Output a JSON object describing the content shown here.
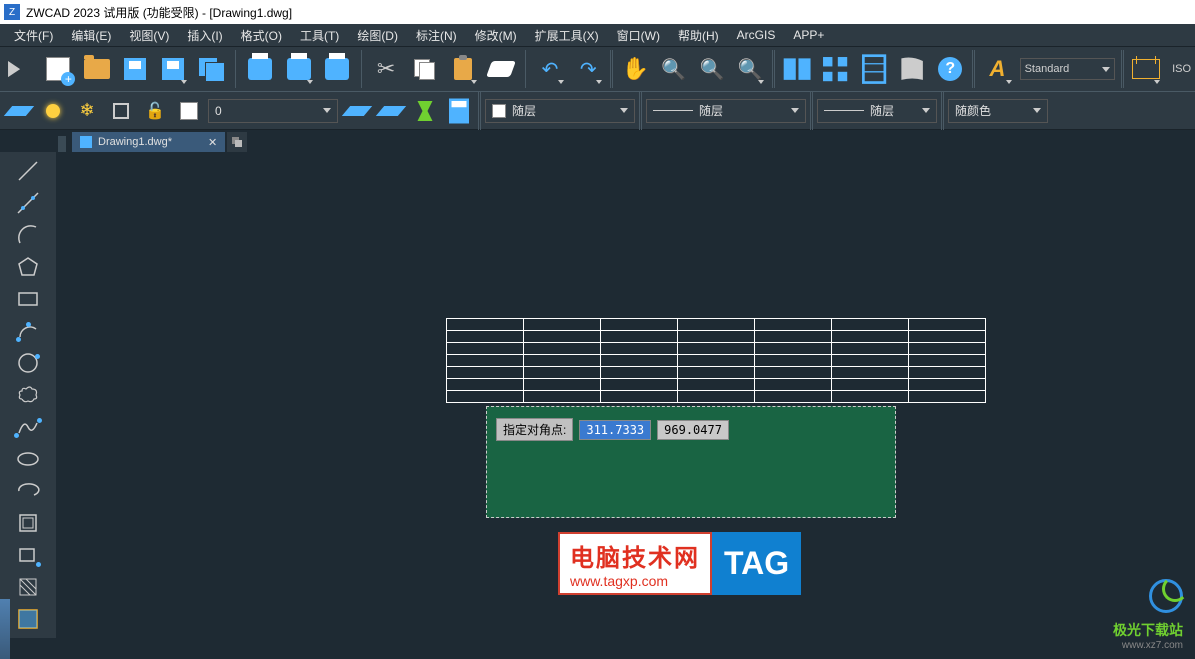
{
  "title": "ZWCAD 2023 试用版 (功能受限) - [Drawing1.dwg]",
  "menu": [
    "文件(F)",
    "编辑(E)",
    "视图(V)",
    "插入(I)",
    "格式(O)",
    "工具(T)",
    "绘图(D)",
    "标注(N)",
    "修改(M)",
    "扩展工具(X)",
    "窗口(W)",
    "帮助(H)",
    "ArcGIS",
    "APP+"
  ],
  "style_select": "Standard",
  "iso_label": "ISO",
  "layer_current": "0",
  "linetype_label": "随层",
  "lineweight_label": "随层",
  "linetype2_label": "随层",
  "color_label": "随颜色",
  "tab_name": "Drawing1.dwg*",
  "dyn_label": "指定对角点:",
  "dyn_x": "311.7333",
  "dyn_y": "969.0477",
  "wm1_t1": "电脑技术网",
  "wm1_t2": "www.tagxp.com",
  "wm1_tag": "TAG",
  "wm2_name": "极光下载站",
  "wm2_url": "www.xz7.com"
}
